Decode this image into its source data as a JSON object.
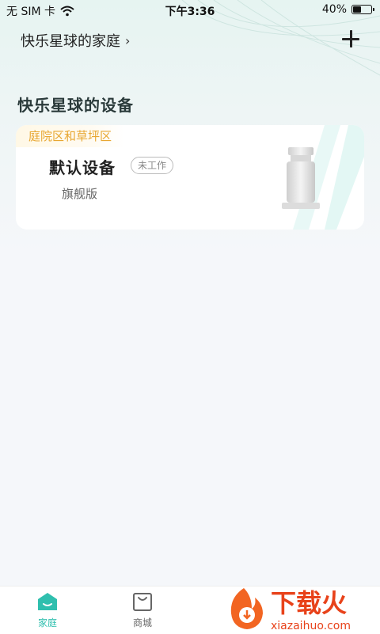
{
  "status_bar": {
    "carrier": "无 SIM 卡",
    "time": "下午3:36",
    "battery": "40%",
    "battery_level": 0.4
  },
  "header": {
    "home_name": "快乐星球的家庭"
  },
  "section": {
    "title": "快乐星球的设备"
  },
  "device": {
    "zone": "庭院区和草坪区",
    "name": "默认设备",
    "status": "未工作",
    "edition": "旗舰版"
  },
  "bottom_nav": {
    "items": [
      {
        "label": "家庭",
        "active": true
      },
      {
        "label": "商城",
        "active": false
      }
    ]
  },
  "watermark": {
    "text": "下载火",
    "url": "xiazaihuo.com"
  },
  "colors": {
    "accent": "#2fbfae",
    "zone_tag": "#e8a732"
  }
}
